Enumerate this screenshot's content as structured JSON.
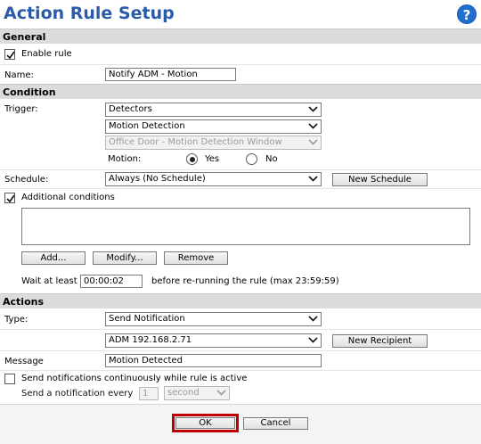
{
  "header": {
    "title": "Action Rule Setup",
    "help_glyph": "?"
  },
  "general": {
    "section_title": "General",
    "enable_rule_label": "Enable rule",
    "enable_rule_checked": true,
    "name_label": "Name:",
    "name_value": "Notify ADM - Motion"
  },
  "condition": {
    "section_title": "Condition",
    "trigger_label": "Trigger:",
    "trigger_value": "Detectors",
    "trigger_sub_value": "Motion Detection",
    "trigger_window_value": "Office Door - Motion Detection Window",
    "motion_label": "Motion:",
    "motion_yes": "Yes",
    "motion_no": "No",
    "motion_selected": "Yes",
    "schedule_label": "Schedule:",
    "schedule_value": "Always (No Schedule)",
    "new_schedule_button": "New Schedule",
    "additional_label": "Additional conditions",
    "additional_checked": true,
    "add_button": "Add...",
    "modify_button": "Modify...",
    "remove_button": "Remove",
    "wait_label": "Wait at least",
    "wait_value": "00:00:02",
    "wait_suffix": "before re-running the rule (max 23:59:59)"
  },
  "actions": {
    "section_title": "Actions",
    "type_label": "Type:",
    "type_value": "Send Notification",
    "recipient_value": "ADM 192.168.2.71",
    "new_recipient_button": "New Recipient",
    "message_label": "Message",
    "message_value": "Motion Detected",
    "continuous_label": "Send notifications continuously while rule is active",
    "continuous_checked": false,
    "every_label": "Send a notification every",
    "every_value": "1",
    "every_unit": "second"
  },
  "footer": {
    "ok_button": "OK",
    "cancel_button": "Cancel"
  },
  "colors": {
    "title": "#2a5ba8",
    "section_bg": "#dcdcdc",
    "ok_highlight": "#c00000",
    "help": "#1f6fd1"
  }
}
